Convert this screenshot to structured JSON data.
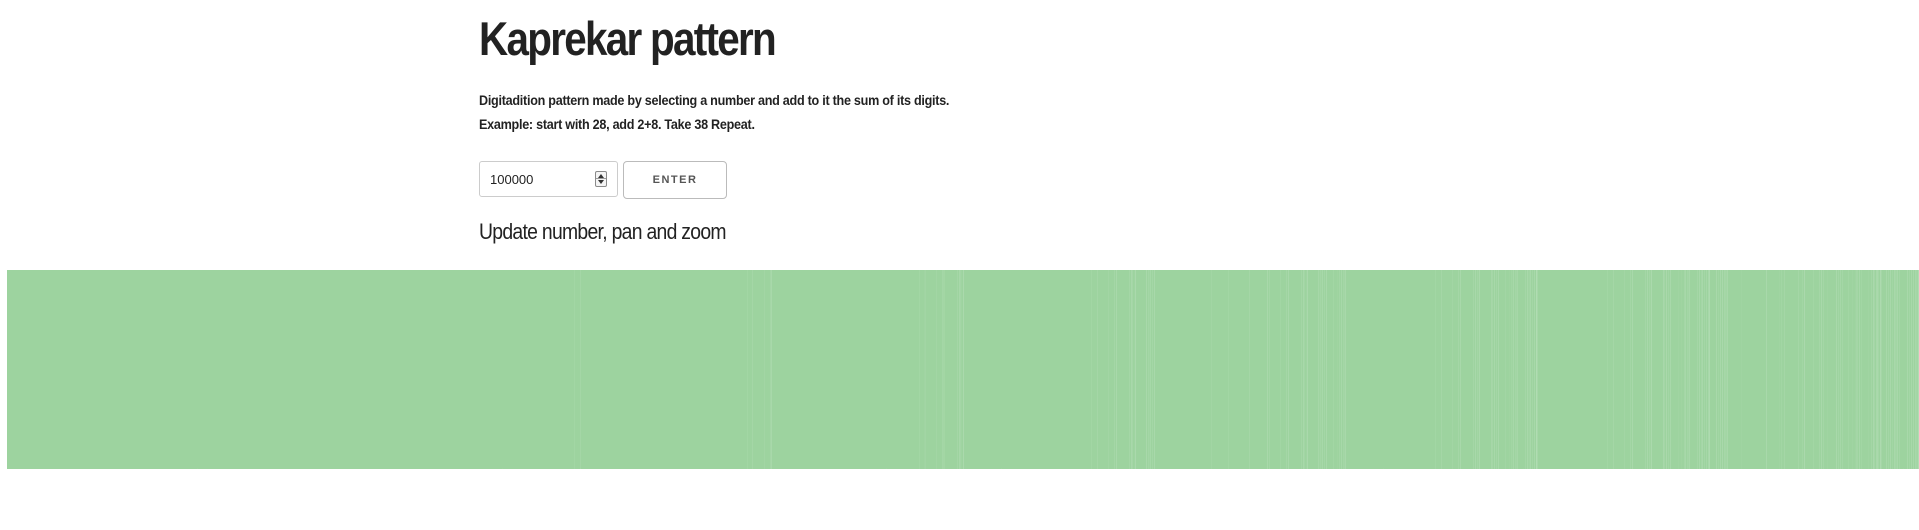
{
  "page": {
    "title": "Kaprekar pattern",
    "description_line1": "Digitadition pattern made by selecting a number and add to it the sum of its digits.",
    "description_line2": "Example: start with 28, add 2+8. Take 38 Repeat.",
    "subheading": "Update number, pan and zoom"
  },
  "controls": {
    "number_value": "100000",
    "enter_label": "ENTER"
  },
  "pattern": {
    "start": 1,
    "limit": 100000,
    "stroke_color": "#4caf50"
  }
}
